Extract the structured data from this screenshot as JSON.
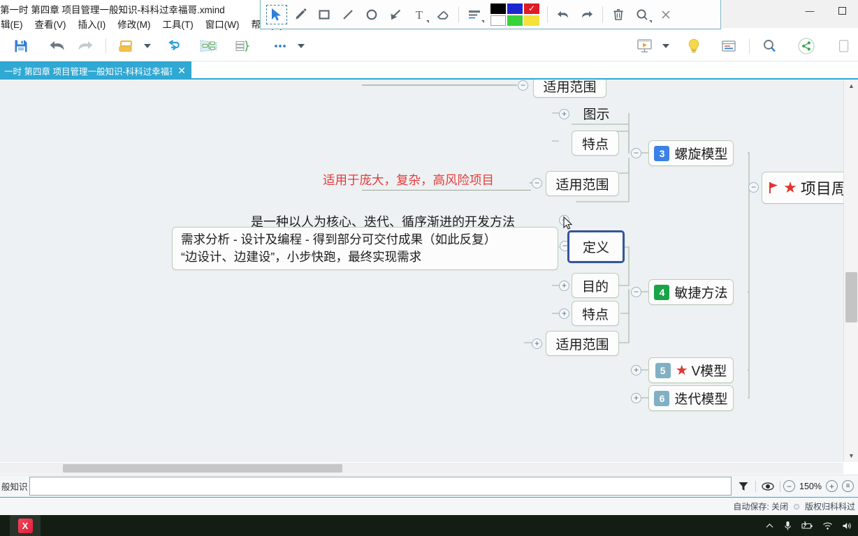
{
  "window": {
    "title": "第一时 第四章 项目管理一般知识-科科过幸福哥.xmind",
    "controls": {
      "minimize": "—",
      "maximize": "▫",
      "close": "✕"
    }
  },
  "menubar": {
    "items": [
      {
        "label": "辑(E)",
        "name": "menu-edit"
      },
      {
        "label": "查看(V)",
        "name": "menu-view"
      },
      {
        "label": "插入(I)",
        "name": "menu-insert"
      },
      {
        "label": "修改(M)",
        "name": "menu-modify"
      },
      {
        "label": "工具(T)",
        "name": "menu-tools"
      },
      {
        "label": "窗口(W)",
        "name": "menu-window"
      },
      {
        "label": "帮助(H)",
        "name": "menu-help"
      }
    ]
  },
  "annotation_toolbar": {
    "tools": [
      {
        "name": "cursor-select-icon",
        "label": "选择"
      },
      {
        "name": "pencil-icon",
        "label": "画笔"
      },
      {
        "name": "rectangle-icon",
        "label": "矩形"
      },
      {
        "name": "line-icon",
        "label": "直线"
      },
      {
        "name": "ellipse-icon",
        "label": "椭圆"
      },
      {
        "name": "arrow-icon",
        "label": "箭头"
      },
      {
        "name": "text-icon",
        "label": "文字"
      },
      {
        "name": "eraser-icon",
        "label": "橡皮擦"
      },
      {
        "name": "line-weight-icon",
        "label": "线宽"
      }
    ],
    "actions": [
      {
        "name": "undo-icon",
        "label": "撤销"
      },
      {
        "name": "redo-icon",
        "label": "重做"
      },
      {
        "name": "delete-icon",
        "label": "删除"
      },
      {
        "name": "zoom-icon",
        "label": "缩放"
      },
      {
        "name": "close-icon",
        "label": "关闭"
      }
    ],
    "colors": {
      "row1": [
        "#000000",
        "#1c27d0",
        "#e01b24"
      ],
      "row2": [
        "#ffffff",
        "#3ad13a",
        "#f5e03c"
      ],
      "selected": "#e01b24"
    }
  },
  "main_toolbar": {
    "buttons": [
      {
        "name": "save-button",
        "label": "保存",
        "color": "#2f7fd6"
      },
      {
        "name": "undo-button",
        "label": "撤销"
      },
      {
        "name": "redo-button",
        "label": "重做"
      },
      {
        "name": "topic-style-button",
        "label": "主题样式"
      },
      {
        "name": "structure-button",
        "label": "结构"
      },
      {
        "name": "map-shape-button",
        "label": "导图形状"
      },
      {
        "name": "outline-button",
        "label": "大纲"
      },
      {
        "name": "more-button",
        "label": "更多"
      }
    ],
    "right_buttons": [
      {
        "name": "presentation-button",
        "label": "演示"
      },
      {
        "name": "brainstorm-button",
        "label": "头脑风暴"
      },
      {
        "name": "notes-button",
        "label": "备注"
      },
      {
        "name": "search-button",
        "label": "搜索"
      },
      {
        "name": "share-button",
        "label": "分享"
      }
    ]
  },
  "tabbar": {
    "tabs": [
      {
        "label": "一时 第四章 项目管理一般知识-科科过幸福哥",
        "close": "✕",
        "active": true
      }
    ]
  },
  "mindmap": {
    "nodes": [
      {
        "id": "n-scope-top",
        "text": "适用范围",
        "name": "node-applicable-scope-top"
      },
      {
        "id": "n-diagram",
        "text": "图示",
        "name": "node-diagram"
      },
      {
        "id": "n-feature-1",
        "text": "特点",
        "name": "node-features-spiral"
      },
      {
        "id": "n-scope-2",
        "text": "适用范围",
        "name": "node-applicable-scope-spiral"
      },
      {
        "id": "n-definition",
        "text": "定义",
        "name": "node-definition"
      },
      {
        "id": "n-purpose",
        "text": "目的",
        "name": "node-purpose"
      },
      {
        "id": "n-feature-2",
        "text": "特点",
        "name": "node-features-agile"
      },
      {
        "id": "n-scope-3",
        "text": "适用范围",
        "name": "node-applicable-scope-agile"
      },
      {
        "id": "n-spiral",
        "text": "螺旋模型",
        "badge": "3",
        "badge_color": "#3b82e8",
        "name": "node-spiral-model"
      },
      {
        "id": "n-agile",
        "text": "敏捷方法",
        "badge": "4",
        "badge_color": "#1aa44a",
        "name": "node-agile-method"
      },
      {
        "id": "n-vmodel",
        "text": "V模型",
        "badge": "5",
        "badge_color": "#80b0c4",
        "star": "★",
        "name": "node-v-model"
      },
      {
        "id": "n-iterative",
        "text": "迭代模型",
        "badge": "6",
        "badge_color": "#80b0c4",
        "name": "node-iterative-model"
      },
      {
        "id": "n-lifecycle",
        "text": "项目周",
        "flag": "⚑",
        "star": "★",
        "name": "node-project-lifecycle"
      }
    ],
    "floating_labels": [
      {
        "id": "t-red",
        "text": "适用于庞大，复杂，高风险项目",
        "color": "#e33b3b",
        "name": "label-spiral-scope-detail"
      },
      {
        "id": "t-def",
        "text": "是一种以人为核心、迭代、循序渐进的开发方法",
        "color": "#1c1c1c",
        "name": "label-agile-definition"
      }
    ],
    "detail_box": {
      "line1": "需求分析 - 设计及编程 - 得到部分可交付成果（如此反复）",
      "line2": "“边设计、边建设”，小步快跑，最终实现需求",
      "name": "node-agile-definition-detail"
    },
    "toggles": {
      "collapse": "−",
      "expand": "+"
    }
  },
  "editbar": {
    "breadcrumb": "般知识",
    "input_value": "",
    "input_placeholder": "",
    "filter_label": "筛选",
    "eye_label": "聚焦",
    "zoom_out": "−",
    "zoom_level": "150%",
    "zoom_in": "+",
    "zoom_fit": "⊜"
  },
  "statusbar": {
    "autosave": "自动保存: 关闭",
    "copyright": "版权归科科过"
  },
  "taskbar": {
    "app_icon_label": "X",
    "tray": [
      "chevron-up-icon",
      "microphone-icon",
      "battery-icon",
      "wifi-icon",
      "volume-icon"
    ]
  }
}
